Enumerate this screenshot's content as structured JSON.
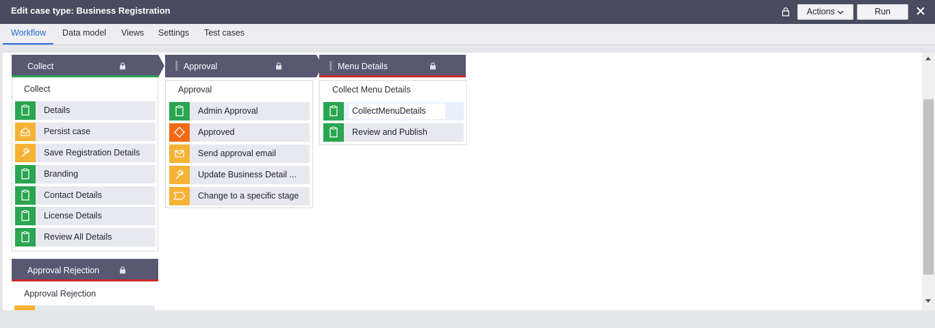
{
  "header": {
    "title": "Edit case type:  Business Registration",
    "actions_label": "Actions",
    "run_label": "Run"
  },
  "tabs": [
    {
      "label": "Workflow",
      "active": true
    },
    {
      "label": "Data model"
    },
    {
      "label": "Views"
    },
    {
      "label": "Settings"
    },
    {
      "label": "Test cases"
    }
  ],
  "colors": {
    "topbar": "#4a4a60",
    "stage_header": "#585873",
    "step_green": "#2aa550",
    "step_yellow": "#f5b336",
    "step_orange": "#f26a14",
    "accent_tab": "#2a6ad6",
    "stage_underline_green": "#2aa550",
    "stage_underline_red": "#c8282d"
  },
  "stages": [
    {
      "name": "Collect",
      "process": "Collect",
      "steps": [
        {
          "label": "Details",
          "icon": "clipboard-icon",
          "color": "green"
        },
        {
          "label": "Persist case",
          "icon": "envelope-open-icon",
          "color": "yellow"
        },
        {
          "label": "Save Registration Details",
          "icon": "wrench-icon",
          "color": "yellow"
        },
        {
          "label": "Branding",
          "icon": "clipboard-icon",
          "color": "green"
        },
        {
          "label": "Contact Details",
          "icon": "clipboard-icon",
          "color": "green"
        },
        {
          "label": "License Details",
          "icon": "clipboard-icon",
          "color": "green"
        },
        {
          "label": "Review All Details",
          "icon": "clipboard-icon",
          "color": "green"
        }
      ]
    },
    {
      "name": "Approval",
      "process": "Approval",
      "steps": [
        {
          "label": "Admin Approval",
          "icon": "clipboard-icon",
          "color": "green"
        },
        {
          "label": "Approved",
          "icon": "diamond-icon",
          "color": "orange"
        },
        {
          "label": "Send approval email",
          "icon": "envelope-icon",
          "color": "yellow"
        },
        {
          "label": "Update Business Detail ...",
          "icon": "wrench-icon",
          "color": "yellow"
        },
        {
          "label": "Change to a specific stage",
          "icon": "chevron-stage-icon",
          "color": "yellow"
        }
      ]
    },
    {
      "name": "Menu Details",
      "process": "Collect Menu Details",
      "steps": [
        {
          "label": "CollectMenuDetails",
          "icon": "clipboard-icon",
          "color": "green",
          "selected": true
        },
        {
          "label": "Review and Publish",
          "icon": "clipboard-icon",
          "color": "green"
        }
      ]
    },
    {
      "name": "Approval Rejection",
      "process": "Approval Rejection",
      "steps": []
    }
  ]
}
